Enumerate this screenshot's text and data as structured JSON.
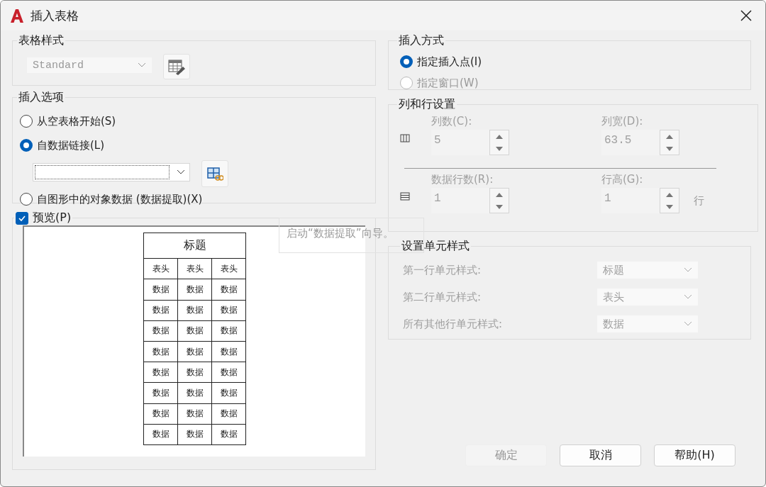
{
  "window": {
    "title": "插入表格"
  },
  "table_style": {
    "legend": "表格样式",
    "value": "Standard",
    "disabled": true
  },
  "insert_options": {
    "legend": "插入选项",
    "options": [
      {
        "label": "从空表格开始(S)",
        "selected": false
      },
      {
        "label": "自数据链接(L)",
        "selected": true
      },
      {
        "label": "自图形中的对象数据 (数据提取)(X)",
        "selected": false
      }
    ]
  },
  "preview": {
    "label": "预览(P)",
    "checked": true,
    "title": "标题",
    "headers": [
      "表头",
      "表头",
      "表头"
    ],
    "rows": [
      [
        "数据",
        "数据",
        "数据"
      ],
      [
        "数据",
        "数据",
        "数据"
      ],
      [
        "数据",
        "数据",
        "数据"
      ],
      [
        "数据",
        "数据",
        "数据"
      ],
      [
        "数据",
        "数据",
        "数据"
      ],
      [
        "数据",
        "数据",
        "数据"
      ],
      [
        "数据",
        "数据",
        "数据"
      ],
      [
        "数据",
        "数据",
        "数据"
      ]
    ]
  },
  "tooltip": "启动“数据提取”向导。",
  "insert_method": {
    "legend": "插入方式",
    "options": [
      {
        "label": "指定插入点(I)",
        "selected": true,
        "disabled": false
      },
      {
        "label": "指定窗口(W)",
        "selected": false,
        "disabled": true
      }
    ]
  },
  "columns_rows": {
    "legend": "列和行设置",
    "disabled": true,
    "columns": {
      "label": "列数(C):",
      "value": "5"
    },
    "column_width": {
      "label": "列宽(D):",
      "value": "63.5"
    },
    "data_rows": {
      "label": "数据行数(R):",
      "value": "1"
    },
    "row_height": {
      "label": "行高(G):",
      "value": "1"
    },
    "row_unit": "行"
  },
  "cell_styles": {
    "legend": "设置单元样式",
    "disabled": true,
    "rows": [
      {
        "label": "第一行单元样式:",
        "value": "标题"
      },
      {
        "label": "第二行单元样式:",
        "value": "表头"
      },
      {
        "label": "所有其他行单元样式:",
        "value": "数据"
      }
    ]
  },
  "buttons": [
    {
      "label": "确定",
      "disabled": true
    },
    {
      "label": "取消",
      "disabled": false
    },
    {
      "label": "帮助(H)",
      "disabled": false
    }
  ]
}
